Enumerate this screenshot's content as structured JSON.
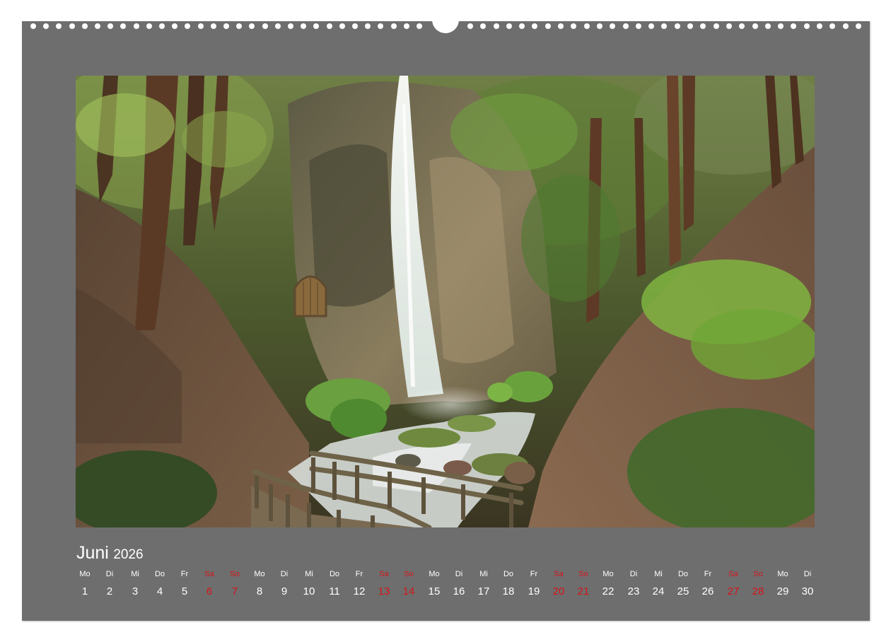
{
  "calendar": {
    "month": "Juni",
    "year": "2026",
    "weekend_color": "#d7141a",
    "text_color": "#ffffff",
    "sheet_color": "#6e6e6e",
    "days": [
      {
        "wd": "Mo",
        "num": "1",
        "weekend": false
      },
      {
        "wd": "Di",
        "num": "2",
        "weekend": false
      },
      {
        "wd": "Mi",
        "num": "3",
        "weekend": false
      },
      {
        "wd": "Do",
        "num": "4",
        "weekend": false
      },
      {
        "wd": "Fr",
        "num": "5",
        "weekend": false
      },
      {
        "wd": "Sa",
        "num": "6",
        "weekend": true
      },
      {
        "wd": "So",
        "num": "7",
        "weekend": true
      },
      {
        "wd": "Mo",
        "num": "8",
        "weekend": false
      },
      {
        "wd": "Di",
        "num": "9",
        "weekend": false
      },
      {
        "wd": "Mi",
        "num": "10",
        "weekend": false
      },
      {
        "wd": "Do",
        "num": "11",
        "weekend": false
      },
      {
        "wd": "Fr",
        "num": "12",
        "weekend": false
      },
      {
        "wd": "Sa",
        "num": "13",
        "weekend": true
      },
      {
        "wd": "So",
        "num": "14",
        "weekend": true
      },
      {
        "wd": "Mo",
        "num": "15",
        "weekend": false
      },
      {
        "wd": "Di",
        "num": "16",
        "weekend": false
      },
      {
        "wd": "Mi",
        "num": "17",
        "weekend": false
      },
      {
        "wd": "Do",
        "num": "18",
        "weekend": false
      },
      {
        "wd": "Fr",
        "num": "19",
        "weekend": false
      },
      {
        "wd": "Sa",
        "num": "20",
        "weekend": true
      },
      {
        "wd": "So",
        "num": "21",
        "weekend": true
      },
      {
        "wd": "Mo",
        "num": "22",
        "weekend": false
      },
      {
        "wd": "Di",
        "num": "23",
        "weekend": false
      },
      {
        "wd": "Mi",
        "num": "24",
        "weekend": false
      },
      {
        "wd": "Do",
        "num": "25",
        "weekend": false
      },
      {
        "wd": "Fr",
        "num": "26",
        "weekend": false
      },
      {
        "wd": "Sa",
        "num": "27",
        "weekend": true
      },
      {
        "wd": "So",
        "num": "28",
        "weekend": true
      },
      {
        "wd": "Mo",
        "num": "29",
        "weekend": false
      },
      {
        "wd": "Di",
        "num": "30",
        "weekend": false
      }
    ]
  },
  "photo": {
    "subject": "waterfall-forest-scene"
  }
}
